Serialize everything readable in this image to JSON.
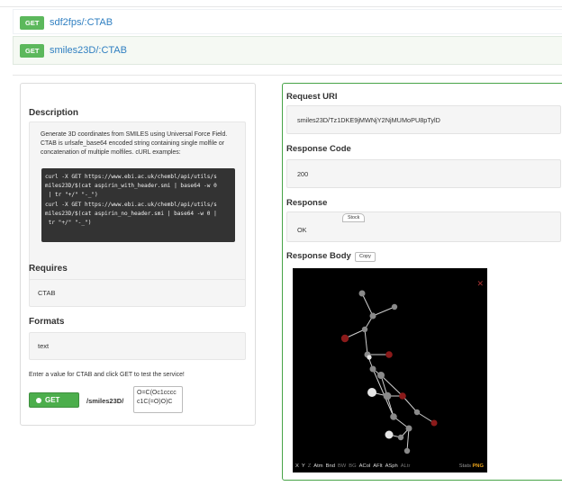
{
  "endpoints": [
    {
      "method": "GET",
      "path": "sdf2fps/:CTAB"
    },
    {
      "method": "GET",
      "path": "smiles23D/:CTAB"
    }
  ],
  "left_panel": {
    "description_heading": "Description",
    "description_text": "Generate 3D coordinates from SMILES using Universal Force Field. CTAB is urlsafe_base64 encoded string containing single molfile or concatenation of multiple molfiles. cURL examples:",
    "code_lines": [
      "curl -X GET https://www.ebi.ac.uk/chembl/api/utils/s",
      "miles23D/$(cat aspirin_with_header.smi | base64 -w 0",
      " | tr \"+/\" \"-_\")",
      "curl -X GET https://www.ebi.ac.uk/chembl/api/utils/s",
      "miles23D/$(cat aspirin_no_header.smi | base64 -w 0 |",
      " tr \"+/\" \"-_\")"
    ],
    "requires_heading": "Requires",
    "requires_value": "CTAB",
    "formats_heading": "Formats",
    "formats_value": "text",
    "prompt": "Enter a value for CTAB and click GET to test the service!",
    "get_button": "GET",
    "path_label": "/smiles23D/",
    "ctab_input_value": "O=C(Oc1cccc\nc1C(=O)O)C"
  },
  "right_panel": {
    "request_uri_heading": "Request URI",
    "request_uri_value": "smiles23D/Tz1DKE9jMWNjY2NjMUMoPU8pTylD",
    "response_code_heading": "Response Code",
    "response_code_value": "200",
    "response_heading": "Response",
    "response_value": "OK",
    "stock_chip": "Stock",
    "response_body_heading": "Response Body",
    "copy_button": "Copy",
    "viewer": {
      "close_symbol": "✕",
      "toolbar": [
        {
          "label": "X",
          "dim": false
        },
        {
          "label": "Y",
          "dim": false
        },
        {
          "label": "Z",
          "dim": true
        },
        {
          "label": "Atm",
          "dim": false
        },
        {
          "label": "Bnd",
          "dim": false
        },
        {
          "label": "BW",
          "dim": true
        },
        {
          "label": "BG",
          "dim": true
        },
        {
          "label": "ACol",
          "dim": false
        },
        {
          "label": "AFlt",
          "dim": false
        },
        {
          "label": "ASph",
          "dim": false
        },
        {
          "label": "ALtr",
          "dim": true
        }
      ],
      "stats_label": "Stats",
      "png_label": "PNG",
      "colors": {
        "background": "#000000",
        "carbon": "#8a8a8a",
        "oxygen": "#8b1a1a",
        "hydrogen": "#e6e6e6",
        "bond": "#cfcfcf"
      }
    }
  }
}
